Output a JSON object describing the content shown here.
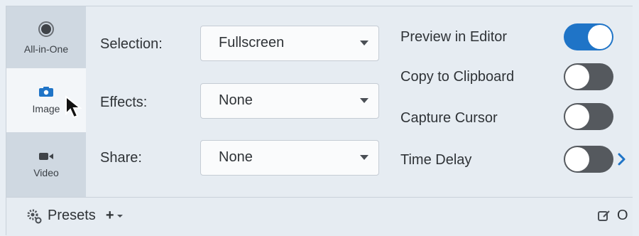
{
  "tabs": [
    {
      "label": "All-in-One",
      "icon": "record-icon"
    },
    {
      "label": "Image",
      "icon": "camera-icon"
    },
    {
      "label": "Video",
      "icon": "video-camera-icon"
    }
  ],
  "settings": {
    "selection": {
      "label": "Selection:",
      "value": "Fullscreen"
    },
    "effects": {
      "label": "Effects:",
      "value": "None"
    },
    "share": {
      "label": "Share:",
      "value": "None"
    }
  },
  "options": {
    "preview": {
      "label": "Preview in Editor",
      "on": true
    },
    "clipboard": {
      "label": "Copy to Clipboard",
      "on": false
    },
    "cursor": {
      "label": "Capture Cursor",
      "on": false
    },
    "delay": {
      "label": "Time Delay",
      "on": false
    }
  },
  "footer": {
    "presets_label": "Presets",
    "add_symbol": "+",
    "right_text": "O"
  },
  "colors": {
    "accent": "#1f74c7",
    "toggle_off": "#55595e"
  }
}
